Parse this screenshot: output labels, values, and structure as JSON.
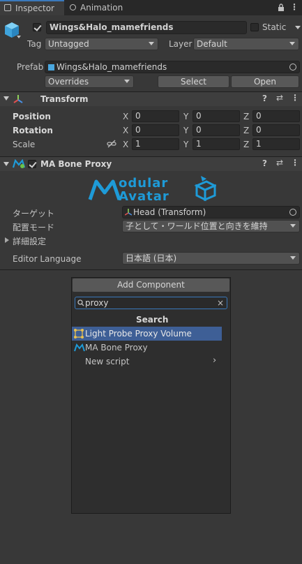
{
  "tabs": [
    {
      "label": "Inspector"
    },
    {
      "label": "Animation"
    }
  ],
  "object": {
    "name": "Wings&Halo_mamefriends",
    "static_label": "Static",
    "tag_label": "Tag",
    "tag_value": "Untagged",
    "layer_label": "Layer",
    "layer_value": "Default",
    "prefab_label": "Prefab",
    "prefab_value": "Wings&Halo_mamefriends",
    "overrides_label": "Overrides",
    "select_label": "Select",
    "open_label": "Open"
  },
  "transform": {
    "title": "Transform",
    "rows": [
      {
        "label": "Position",
        "x": "0",
        "y": "0",
        "z": "0"
      },
      {
        "label": "Rotation",
        "x": "0",
        "y": "0",
        "z": "0"
      },
      {
        "label": "Scale",
        "x": "1",
        "y": "1",
        "z": "1"
      }
    ],
    "axis": {
      "x": "X",
      "y": "Y",
      "z": "Z"
    }
  },
  "bone_proxy": {
    "title": "MA Bone Proxy",
    "logo_line1": "odular",
    "logo_line2": "Avatar",
    "target_label": "ターゲット",
    "target_value": "Head (Transform)",
    "placement_label": "配置モード",
    "placement_value": "子として・ワールド位置と向きを維持",
    "advanced_label": "詳細設定",
    "language_label": "Editor Language",
    "language_value": "日本語 (日本)"
  },
  "add_component": {
    "button_label": "Add Component",
    "search_value": "proxy",
    "section_title": "Search",
    "results": [
      {
        "label": "Light Probe Proxy Volume",
        "icon": "light-probe-icon"
      },
      {
        "label": "MA Bone Proxy",
        "icon": "modular-avatar-icon"
      },
      {
        "label": "New script",
        "icon": ""
      }
    ]
  },
  "colors": {
    "accent": "#3a79bb",
    "selection": "#3e5f96",
    "logo": "#1e9bd8"
  }
}
